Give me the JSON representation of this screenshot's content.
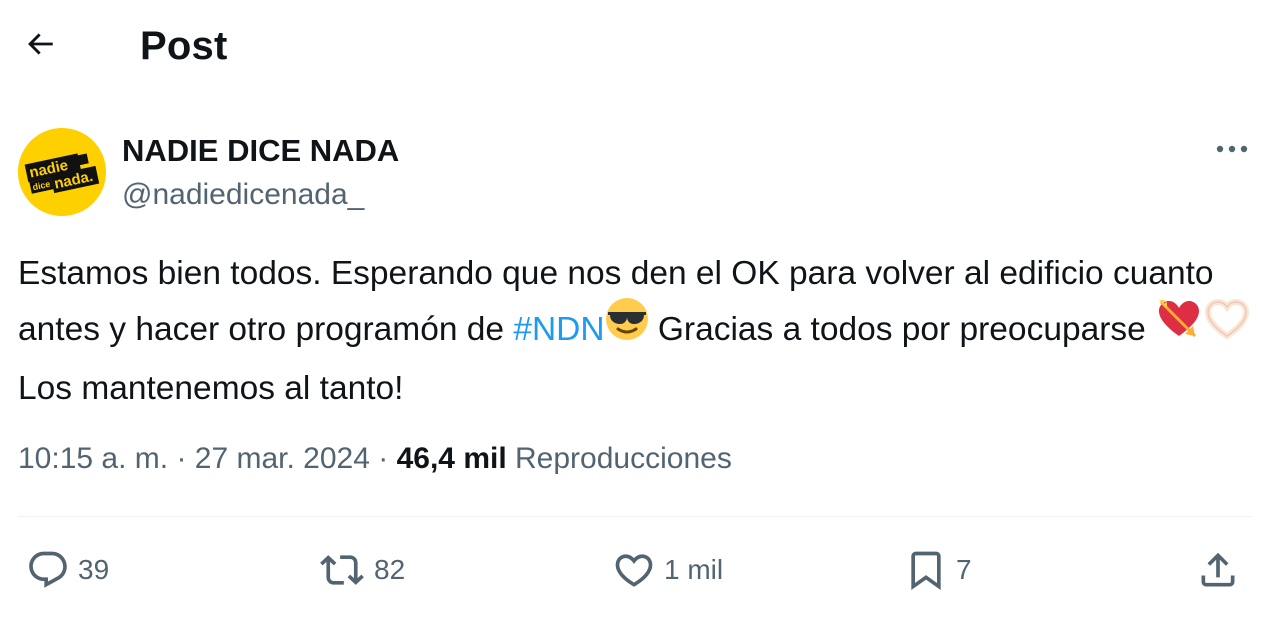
{
  "header": {
    "title": "Post"
  },
  "author": {
    "name": "NADIE DICE NADA",
    "handle": "@nadiedicenada_",
    "avatar_text_top": "nadie",
    "avatar_text_mid": "dice",
    "avatar_text_bottom": "nada.",
    "avatar_color": "#ffd000"
  },
  "tweet": {
    "text_part1": "Estamos bien todos. Esperando que nos den el OK para volver al edificio cuanto antes y hacer otro programón de ",
    "hashtag": "#NDN",
    "text_part2": " Gracias a todos por preocuparse ",
    "text_part3": " Los mantenemos al tanto!",
    "emojis": [
      "smiling-face-with-sunglasses",
      "heart-with-arrow",
      "heart-hands"
    ]
  },
  "meta": {
    "time": "10:15 a. m.",
    "separator": "·",
    "date": "27 mar. 2024",
    "views_count": "46,4 mil",
    "views_label": "Reproducciones"
  },
  "actions": {
    "replies": "39",
    "reposts": "82",
    "likes": "1 mil",
    "bookmarks": "7"
  },
  "colors": {
    "text": "#0f1419",
    "secondary": "#536471",
    "link": "#1d9bf0",
    "divider": "#eff3f4"
  }
}
